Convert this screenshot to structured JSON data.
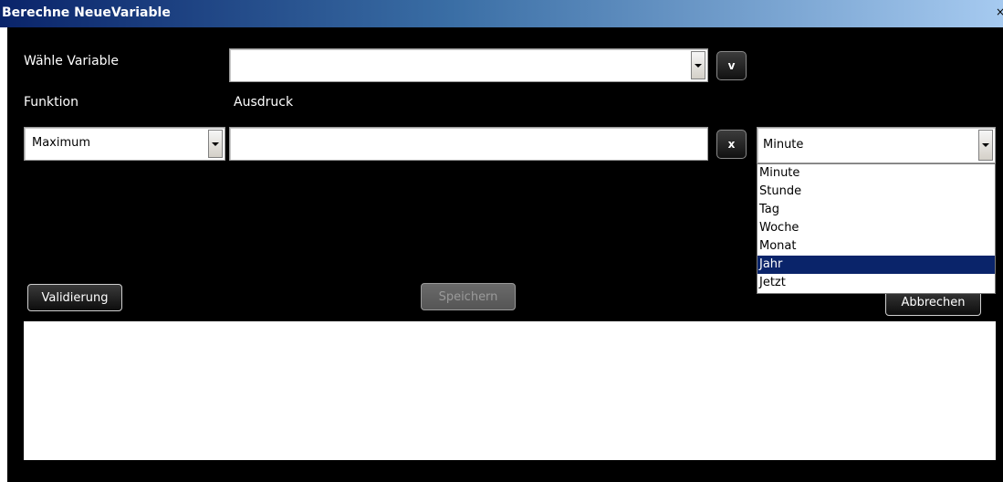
{
  "window": {
    "title": "Berechne NeueVariable",
    "close_label": "×"
  },
  "form": {
    "variable_label": "Wähle Variable",
    "variable_value": "",
    "variable_button": "v",
    "function_label": "Funktion",
    "expression_label": "Ausdruck",
    "function_value": "Maximum",
    "expression_value": "",
    "clear_button": "x",
    "unit_value": "Minute",
    "unit_options": [
      "Minute",
      "Stunde",
      "Tag",
      "Woche",
      "Monat",
      "Jahr",
      "Jetzt"
    ],
    "unit_highlighted_index": 5
  },
  "buttons": {
    "validate": "Validierung",
    "save": "Speichern",
    "cancel": "Abbrechen"
  },
  "output": {
    "text": ""
  },
  "colors": {
    "title_gradient_start": "#0a246a",
    "client_background": "#000000",
    "selection": "#0a246a"
  }
}
